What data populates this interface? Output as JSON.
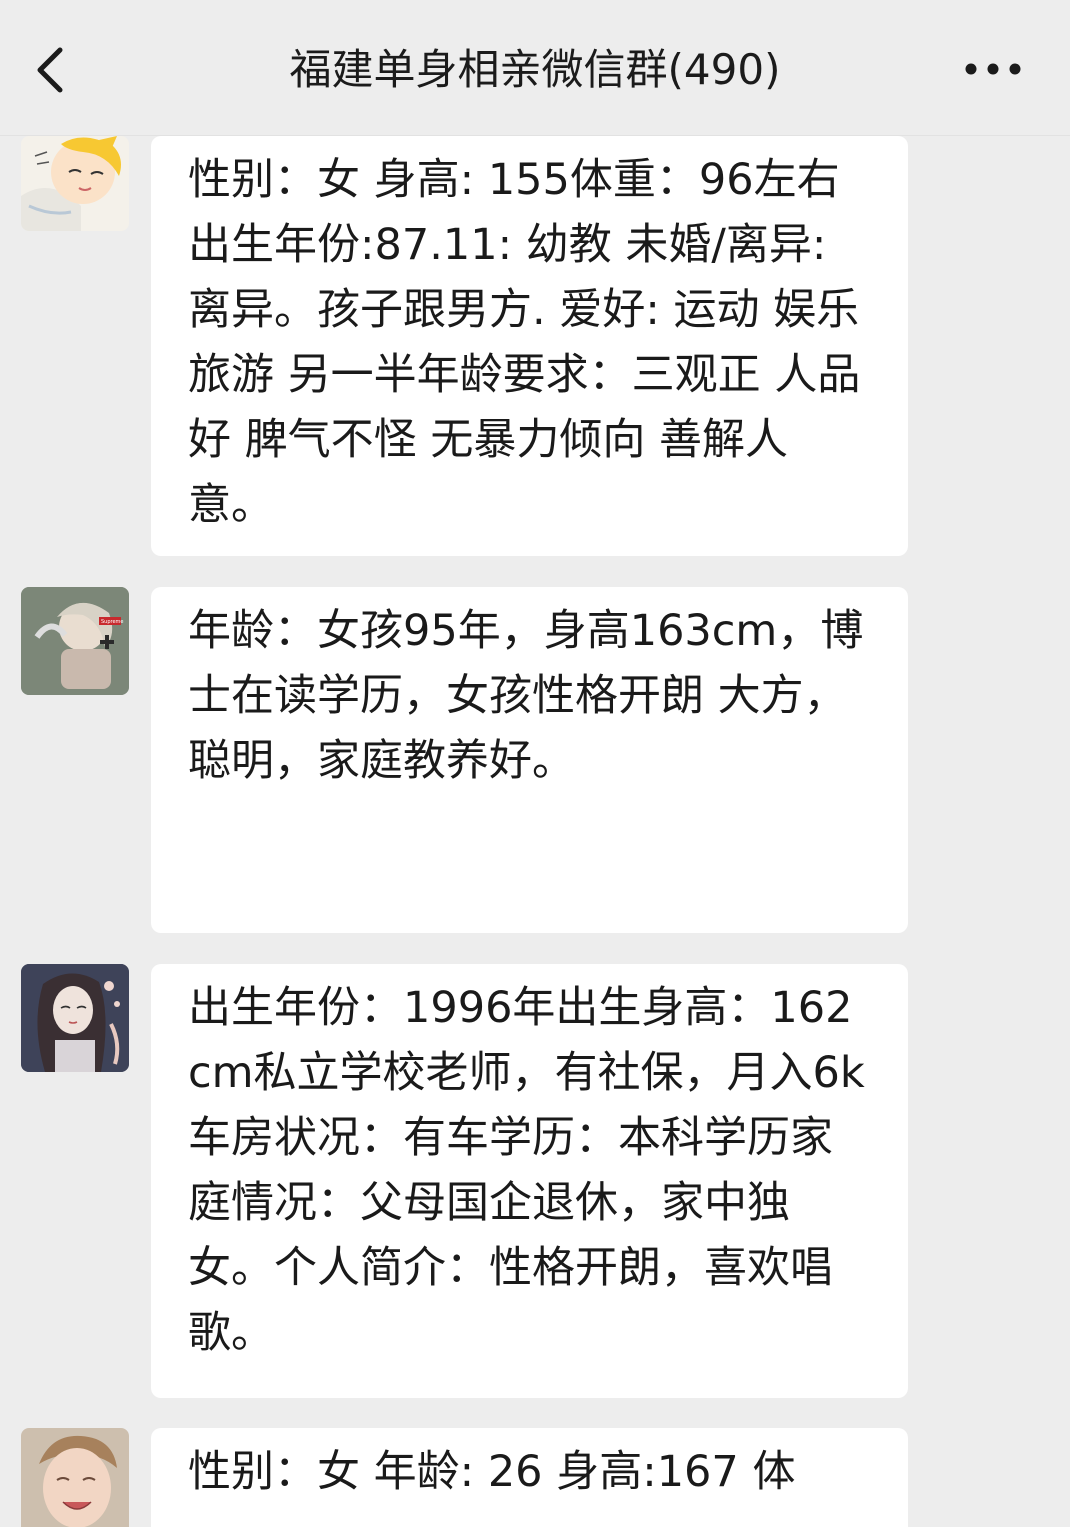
{
  "nav": {
    "title": "福建单身相亲微信群(490)"
  },
  "messages": [
    {
      "text": "性别：女  身高: 155体重：96左右出生年份:87.11: 幼教 未婚/离异: 离异。孩子跟男方. 爱好: 运动 娱乐 旅游 另一半年龄要求：三观正 人品好 脾气不怪 无暴力倾向 善解人意。"
    },
    {
      "text": "年龄：女孩95年，身高163cm，博士在读学历，女孩性格开朗 大方，聪明，家庭教养好。"
    },
    {
      "text": "出生年份：1996年出生身高：162cm私立学校老师，有社保，月入6k车房状况：有车学历：本科学历家庭情况：父母国企退休，家中独女。个人简介：性格开朗，喜欢唱歌。"
    },
    {
      "text": "性别：女 年龄: 26 身高:167 体"
    }
  ]
}
